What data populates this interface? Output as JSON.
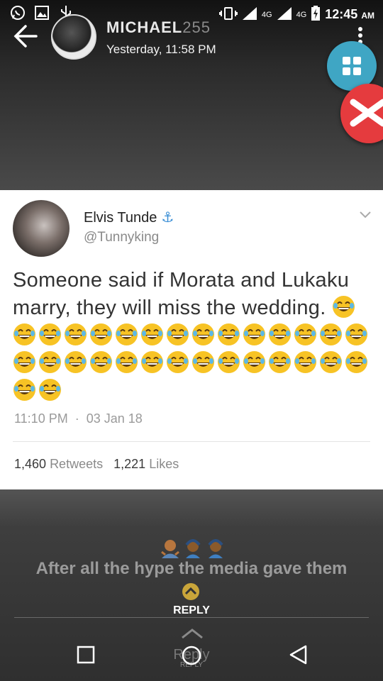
{
  "status_bar": {
    "network_1": "4G",
    "network_2": "4G",
    "time": "12:45",
    "ampm": "AM",
    "icons": [
      "whatsapp-icon",
      "gallery-icon",
      "usb-icon",
      "vibrate-icon",
      "signal-icon",
      "signal-icon",
      "battery-charging-icon"
    ]
  },
  "header": {
    "contact_name": "MICHAEL",
    "contact_name_ghost": "255",
    "subtitle": "Yesterday, 11:58 PM"
  },
  "tweet": {
    "author_name": "Elvis Tunde",
    "author_handle": "@Tunnyking",
    "text": "Someone said if Morata and Lukaku marry, they will miss the wedding.",
    "emoji_count": 31,
    "time": "11:10 PM",
    "separator": "·",
    "date": "03 Jan 18",
    "retweets_count": "1,460",
    "retweets_label": "Retweets",
    "likes_count": "1,221",
    "likes_label": "Likes"
  },
  "reply_area": {
    "caption": "After all the hype the media gave them",
    "reply_label": "REPLY",
    "ghost_reply": "Reply",
    "ghost_reply_small": "REPLY"
  },
  "colors": {
    "fab_grid": "#3fa6c4",
    "fab_close": "#e53b3e",
    "twitter_blue": "#3b8fd6",
    "emoji_yellow": "#f7c325"
  }
}
